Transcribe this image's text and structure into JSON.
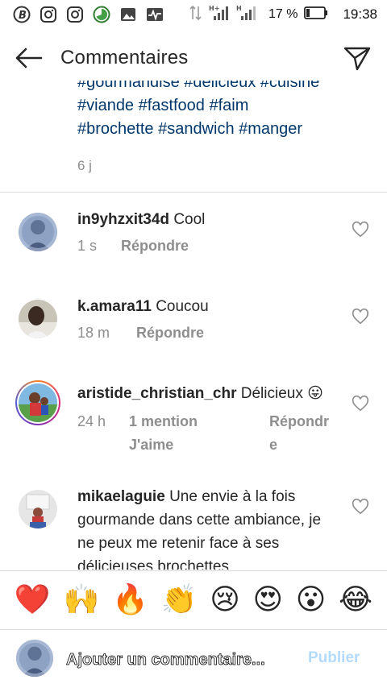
{
  "status_bar": {
    "icons": [
      "b-circle-icon",
      "instagram-icon",
      "instagram-icon",
      "download-progress-icon",
      "gallery-icon",
      "pulse-icon"
    ],
    "battery_percent": "17 %",
    "time": "19:38"
  },
  "header": {
    "title": "Commentaires",
    "back_icon": "arrow-left-icon",
    "share_icon": "send-icon"
  },
  "caption": {
    "lines": [
      "#gourmandise #délicieux #cuisine",
      "#viande #fastfood #faim",
      "#brochette #sandwich #manger"
    ],
    "time": "6 j"
  },
  "comments": [
    {
      "username": "in9yhzxit34d",
      "text": "Cool",
      "time": "1 s",
      "reply_label": "Répondre"
    },
    {
      "username": "k.amara11",
      "text": "Coucou",
      "time": "18 m",
      "reply_label": "Répondre"
    },
    {
      "username": "aristide_christian_chr",
      "text": "Délicieux 😛",
      "time": "24 h",
      "likes_label": "1 mention J'aime",
      "reply_label": "Répondre"
    },
    {
      "username": "mikaelaguie",
      "text": "Une envie à la fois gourmande dans cette ambiance, je ne peux me retenir face à ses délicieuses brochettes"
    }
  ],
  "emoji_bar": [
    "❤️",
    "🙌",
    "🔥",
    "👏",
    "😢",
    "😍",
    "😮",
    "😂"
  ],
  "input": {
    "placeholder": "Ajouter un commentaire...",
    "post_label": "Publier"
  },
  "colors": {
    "hashtag": "#00376b",
    "muted": "#8e8e8e",
    "post_disabled": "#b3dbff"
  }
}
